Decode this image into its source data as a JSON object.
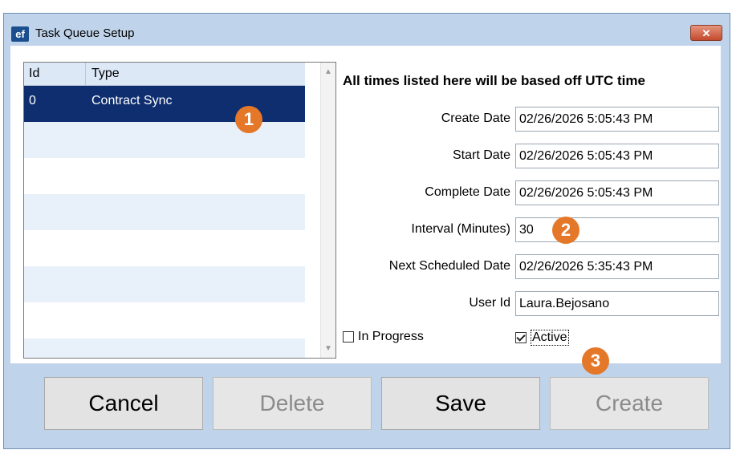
{
  "window": {
    "title": "Task Queue Setup",
    "app_icon_text": "ef",
    "close_glyph": "✕"
  },
  "grid": {
    "columns": [
      "Id",
      "Type"
    ],
    "rows": [
      {
        "id": "0",
        "type": "Contract Sync",
        "selected": true
      }
    ],
    "scroll_up": "▲",
    "scroll_down": "▼"
  },
  "callouts": {
    "one": "1",
    "two": "2",
    "three": "3"
  },
  "form": {
    "notice": "All times listed here will be based off UTC time",
    "create_date": {
      "label": "Create Date",
      "value": "02/26/2026 5:05:43 PM"
    },
    "start_date": {
      "label": "Start Date",
      "value": "02/26/2026 5:05:43 PM"
    },
    "complete_date": {
      "label": "Complete Date",
      "value": "02/26/2026 5:05:43 PM"
    },
    "interval": {
      "label": "Interval (Minutes)",
      "value": "30"
    },
    "next_scheduled": {
      "label": "Next Scheduled Date",
      "value": "02/26/2026 5:35:43 PM"
    },
    "user_id": {
      "label": "User Id",
      "value": "Laura.Bejosano"
    },
    "in_progress": {
      "label": "In Progress",
      "checked": false
    },
    "active": {
      "label": "Active",
      "checked": true
    }
  },
  "buttons": {
    "cancel": "Cancel",
    "delete": "Delete",
    "save": "Save",
    "create": "Create"
  },
  "colors": {
    "selection": "#0f2e6f",
    "callout": "#e57729",
    "window_frame": "#bfd3ea"
  }
}
